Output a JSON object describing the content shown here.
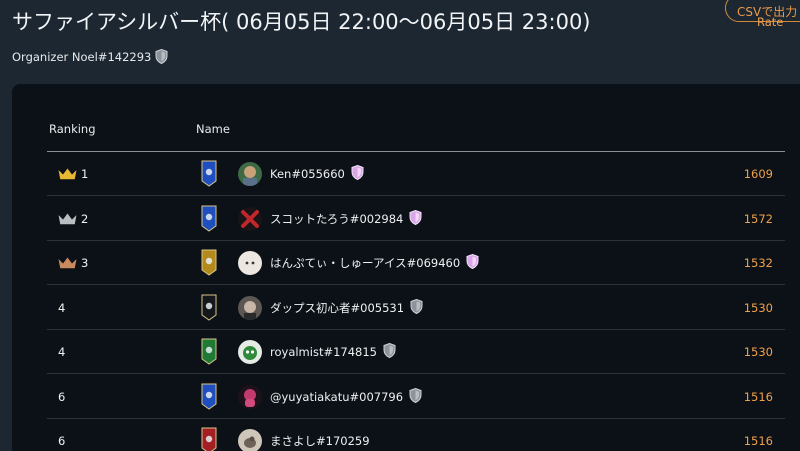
{
  "header": {
    "title": "サファイアシルバー杯( 06月05日 22:00〜06月05日 23:00)",
    "csv_button": "CSVで出力",
    "organizer": "Organizer Noel#142293"
  },
  "table": {
    "columns": {
      "ranking": "Ranking",
      "name": "Name",
      "rate": "Rate"
    },
    "rows": [
      {
        "rank": "1",
        "player": "Ken#055660",
        "rate": "1609",
        "crown": "gold",
        "banner": "blue",
        "badge": "pink-shield-icon",
        "avatar": "green"
      },
      {
        "rank": "2",
        "player": "スコットたろう#002984",
        "rate": "1572",
        "crown": "silver",
        "banner": "blue",
        "badge": "pink-shield-icon",
        "avatar": "red-x"
      },
      {
        "rank": "3",
        "player": "はんぷてぃ・しゅーアイス#069460",
        "rate": "1532",
        "crown": "bronze",
        "banner": "gold",
        "badge": "pink-shield-icon",
        "avatar": "light"
      },
      {
        "rank": "4",
        "player": "ダップス初心者#005531",
        "rate": "1530",
        "crown": "",
        "banner": "black",
        "badge": "silver-shield-icon",
        "avatar": "face"
      },
      {
        "rank": "4",
        "player": "royalmist#174815",
        "rate": "1530",
        "crown": "",
        "banner": "green",
        "badge": "silver-shield-icon",
        "avatar": "cat"
      },
      {
        "rank": "6",
        "player": "@yuyatiakatu#007796",
        "rate": "1516",
        "crown": "",
        "banner": "blue",
        "badge": "silver-shield-icon",
        "avatar": "pink"
      },
      {
        "rank": "6",
        "player": "まさよし#170259",
        "rate": "1516",
        "crown": "",
        "banner": "red",
        "badge": "",
        "avatar": "bird"
      }
    ]
  },
  "colors": {
    "background": "#1c2732",
    "panel": "#0b1117",
    "rate": "#f0a04b",
    "accent": "#d08a3c"
  }
}
